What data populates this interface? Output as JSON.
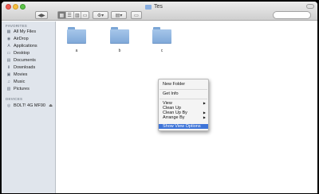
{
  "window": {
    "title": "Tes"
  },
  "toolbar": {
    "back_glyph": "◀▶",
    "view_glyphs": [
      "▦",
      "☰",
      "▥",
      "▭"
    ],
    "action_glyph": "⚙▾",
    "arrange_glyph": "▤▾",
    "share_glyph": "▭"
  },
  "sidebar": {
    "favorites_header": "FAVORITES",
    "favorites": [
      {
        "label": "All My Files",
        "icon": "all-files-icon",
        "glyph": "▦"
      },
      {
        "label": "AirDrop",
        "icon": "airdrop-icon",
        "glyph": "◉"
      },
      {
        "label": "Applications",
        "icon": "applications-icon",
        "glyph": "A"
      },
      {
        "label": "Desktop",
        "icon": "desktop-icon",
        "glyph": "▭"
      },
      {
        "label": "Documents",
        "icon": "documents-icon",
        "glyph": "▤"
      },
      {
        "label": "Downloads",
        "icon": "downloads-icon",
        "glyph": "⬇"
      },
      {
        "label": "Movies",
        "icon": "movies-icon",
        "glyph": "▣"
      },
      {
        "label": "Music",
        "icon": "music-icon",
        "glyph": "♫"
      },
      {
        "label": "Pictures",
        "icon": "pictures-icon",
        "glyph": "▧"
      }
    ],
    "devices_header": "DEVICES",
    "devices": [
      {
        "label": "BOLT! 4G MF90",
        "icon": "drive-icon",
        "glyph": "◎",
        "eject": "⏏"
      }
    ]
  },
  "content": {
    "items": [
      {
        "name": "a",
        "icon": "folder-icon"
      },
      {
        "name": "b",
        "icon": "folder-icon"
      },
      {
        "name": "c",
        "icon": "folder-icon"
      }
    ]
  },
  "context_menu": {
    "items": [
      {
        "label": "New Folder",
        "submenu": false
      },
      {
        "label": "Get Info",
        "submenu": false
      },
      {
        "label": "View",
        "submenu": true
      },
      {
        "label": "Clean Up",
        "submenu": false
      },
      {
        "label": "Clean Up By",
        "submenu": true
      },
      {
        "label": "Arrange By",
        "submenu": true
      },
      {
        "label": "Show View Options",
        "submenu": false,
        "highlighted": true
      }
    ],
    "arrow": "▶"
  },
  "colors": {
    "highlight": "#3e74d8",
    "sidebar_bg": "#e0e5ec",
    "folder": "#8fb4e2"
  }
}
